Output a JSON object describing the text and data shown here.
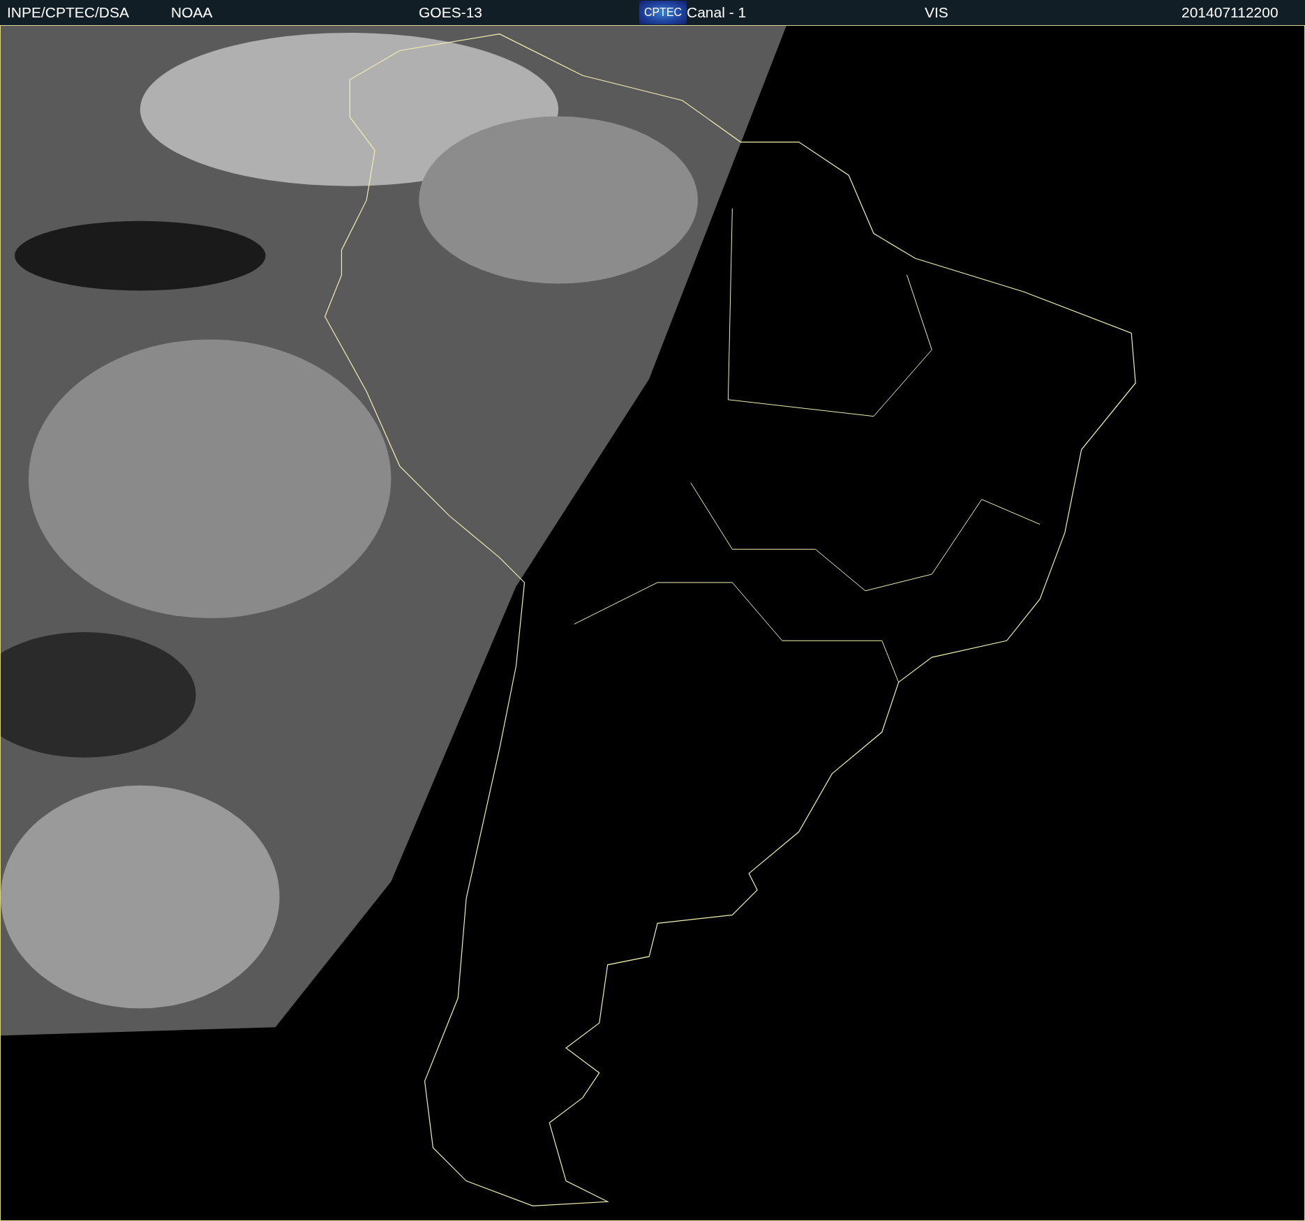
{
  "header": {
    "source": "INPE/CPTEC/DSA",
    "agency": "NOAA",
    "satellite": "GOES-13",
    "logo": "CPTEC",
    "channel": "Canal - 1",
    "band": "VIS",
    "timestamp": "201407112200"
  }
}
